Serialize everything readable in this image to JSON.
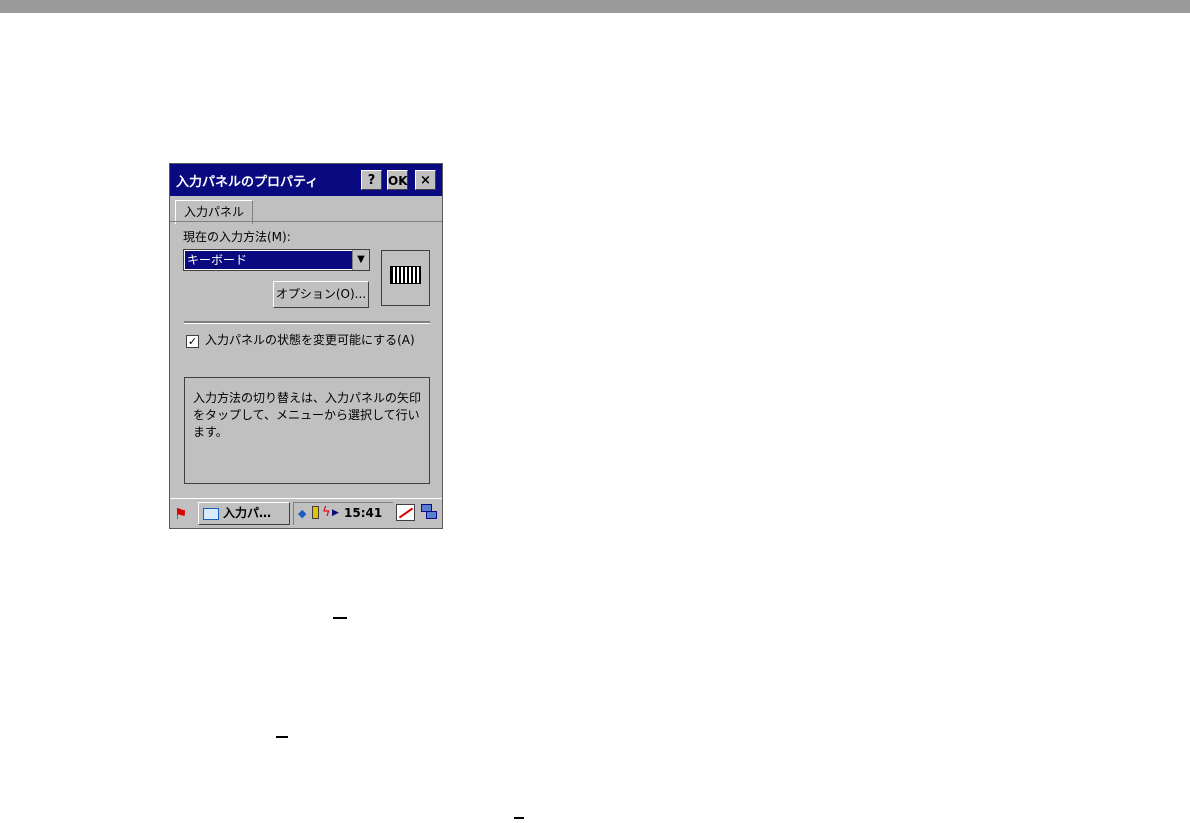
{
  "window": {
    "title": "入力パネルのプロパティ",
    "help_label": "?",
    "ok_label": "OK",
    "close_label": "×"
  },
  "tab": {
    "label": "入力パネル"
  },
  "method": {
    "label": "現在の入力方法(M):",
    "selected": "キーボード",
    "arrow": "▼",
    "options_button": "オプション(O)..."
  },
  "checkbox": {
    "checked": true,
    "mark": "✓",
    "label": "入力パネルの状態を変更可能にする(A)"
  },
  "info": {
    "text": "入力方法の切り替えは、入力パネルの矢印をタップして、メニューから選択して行います。"
  },
  "taskbar": {
    "start_glyph": "⚑",
    "task_label": "入力パ…",
    "clock": "15:41"
  },
  "colors": {
    "titlebar": "#0a0a80",
    "window_bg": "#c0c0c0",
    "top_bar": "#9a9a9a"
  }
}
